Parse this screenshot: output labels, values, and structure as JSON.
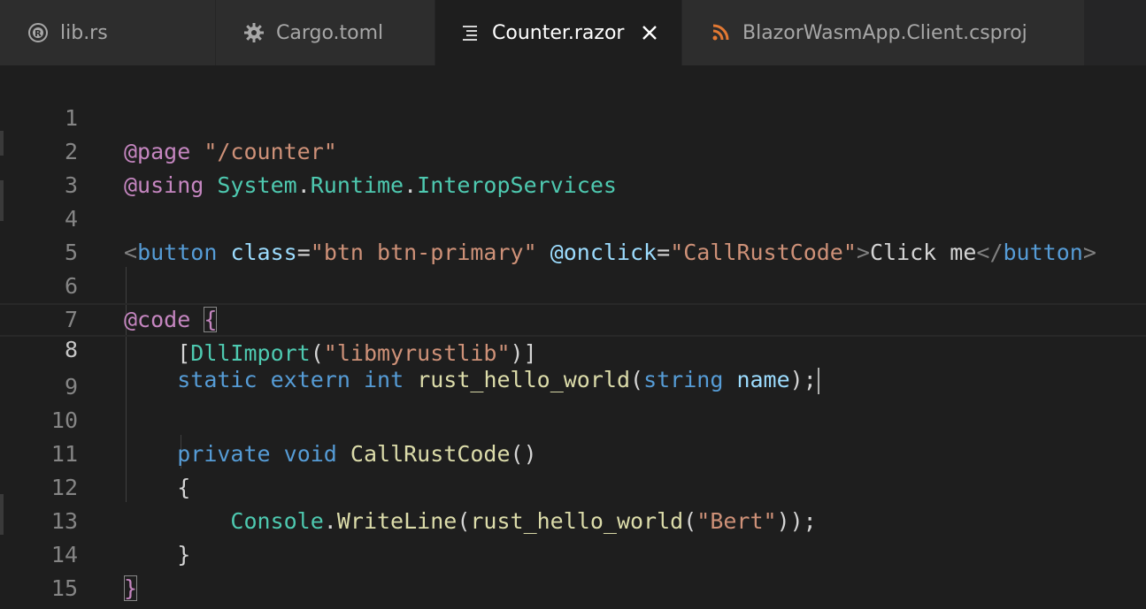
{
  "tabs": [
    {
      "label": "lib.rs",
      "icon": "rust-icon",
      "active": false
    },
    {
      "label": "Cargo.toml",
      "icon": "gear-icon",
      "active": false
    },
    {
      "label": "Counter.razor",
      "icon": "lines-icon",
      "active": true
    },
    {
      "label": "BlazorWasmApp.Client.csproj",
      "icon": "rss-icon",
      "active": false
    }
  ],
  "colors": {
    "rss_icon": "#e37933",
    "directive": "#c586c0",
    "string": "#ce9178",
    "type": "#4ec9b0",
    "keyword": "#569cd6",
    "function": "#dcdcaa",
    "variable": "#9cdcfe"
  },
  "editor": {
    "current_line": 8,
    "lines": [
      {
        "n": "1"
      },
      {
        "n": "2"
      },
      {
        "n": "3"
      },
      {
        "n": "4"
      },
      {
        "n": "5"
      },
      {
        "n": "6"
      },
      {
        "n": "7"
      },
      {
        "n": "8"
      },
      {
        "n": "9"
      },
      {
        "n": "10"
      },
      {
        "n": "11"
      },
      {
        "n": "12"
      },
      {
        "n": "13"
      },
      {
        "n": "14"
      },
      {
        "n": "15"
      }
    ],
    "code": {
      "l1_dir": "@page",
      "l1_str": "\"/counter\"",
      "l2_dir": "@using",
      "l2_ns1": "System",
      "l2_ns2": "Runtime",
      "l2_ns3": "InteropServices",
      "l4_open": "<",
      "l4_tag": "button",
      "l4_attr1": "class",
      "l4_val1": "\"btn btn-primary\"",
      "l4_attr2": "@onclick",
      "l4_val2": "\"CallRustCode\"",
      "l4_text": "Click me",
      "l4_close_open": "</",
      "l4_close_tag": "button",
      "l4_close_end": ">",
      "l6_dir": "@code",
      "l6_brace": "{",
      "l7_type": "DllImport",
      "l7_str": "\"libmyrustlib\"",
      "l8_kw1": "static",
      "l8_kw2": "extern",
      "l8_kw3": "int",
      "l8_fn": "rust_hello_world",
      "l8_kw4": "string",
      "l8_param": "name",
      "l10_kw1": "private",
      "l10_kw2": "void",
      "l10_fn": "CallRustCode",
      "l11_brace": "{",
      "l12_type": "Console",
      "l12_fn1": "WriteLine",
      "l12_fn2": "rust_hello_world",
      "l12_str": "\"Bert\"",
      "l13_brace": "}",
      "l14_brace": "}"
    }
  }
}
